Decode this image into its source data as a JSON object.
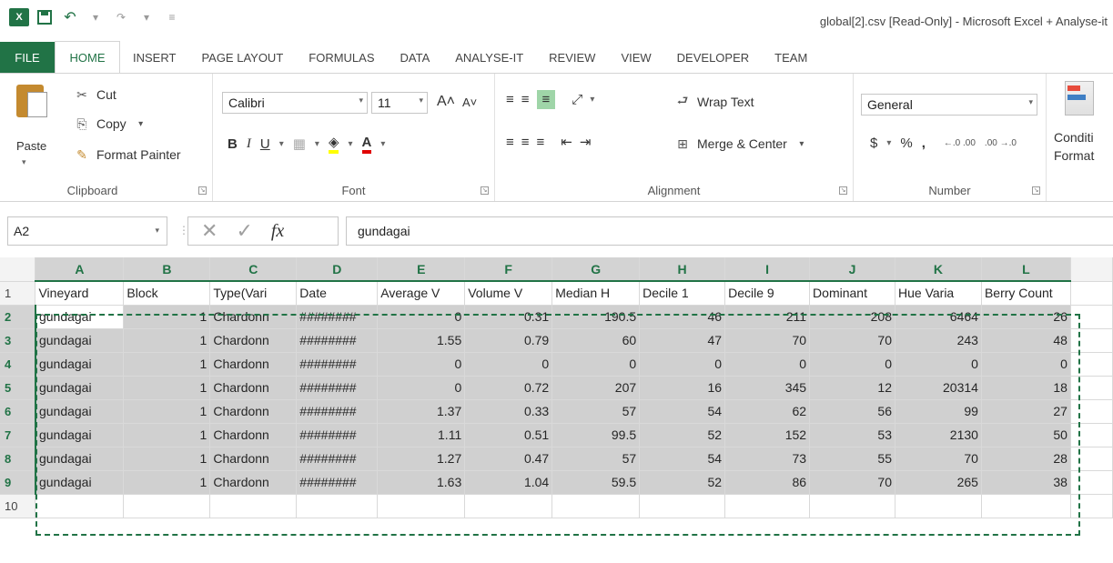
{
  "window": {
    "logo": "X",
    "title": "global[2].csv  [Read-Only] - Microsoft Excel + Analyse-it"
  },
  "tabs": [
    "FILE",
    "HOME",
    "INSERT",
    "PAGE LAYOUT",
    "FORMULAS",
    "DATA",
    "ANALYSE-IT",
    "REVIEW",
    "VIEW",
    "DEVELOPER",
    "TEAM"
  ],
  "ribbon": {
    "clipboard": {
      "paste": "Paste",
      "cut": "Cut",
      "copy": "Copy",
      "format_painter": "Format Painter",
      "label": "Clipboard"
    },
    "font": {
      "name": "Calibri",
      "size": "11",
      "label": "Font",
      "bold": "B",
      "italic": "I",
      "underline": "U"
    },
    "alignment": {
      "wrap_text": "Wrap Text",
      "merge_center": "Merge & Center",
      "label": "Alignment"
    },
    "number": {
      "format": "General",
      "currency": "$",
      "percent": "%",
      "comma": ",",
      "label": "Number",
      "inc_decimal": "←.0 .00",
      "dec_decimal": ".00 →.0"
    },
    "styles": {
      "conditional_formatting": "Conditi",
      "format": "Format"
    }
  },
  "formula_bar": {
    "name_box": "A2",
    "fx": "fx",
    "value": "gundagai"
  },
  "grid": {
    "columns": [
      "A",
      "B",
      "C",
      "D",
      "E",
      "F",
      "G",
      "H",
      "I",
      "J",
      "K",
      "L"
    ],
    "header_row": [
      "Vineyard",
      "Block",
      "Type(Vari",
      "Date",
      "Average V",
      "Volume V",
      "Median H",
      "Decile 1",
      "Decile 9",
      "Dominant",
      "Hue Varia",
      "Berry Count"
    ],
    "rows": [
      [
        "gundagai",
        "1",
        "Chardonn",
        "########",
        "0",
        "0.31",
        "190.5",
        "46",
        "211",
        "208",
        "6464",
        "26"
      ],
      [
        "gundagai",
        "1",
        "Chardonn",
        "########",
        "1.55",
        "0.79",
        "60",
        "47",
        "70",
        "70",
        "243",
        "48"
      ],
      [
        "gundagai",
        "1",
        "Chardonn",
        "########",
        "0",
        "0",
        "0",
        "0",
        "0",
        "0",
        "0",
        "0"
      ],
      [
        "gundagai",
        "1",
        "Chardonn",
        "########",
        "0",
        "0.72",
        "207",
        "16",
        "345",
        "12",
        "20314",
        "18"
      ],
      [
        "gundagai",
        "1",
        "Chardonn",
        "########",
        "1.37",
        "0.33",
        "57",
        "54",
        "62",
        "56",
        "99",
        "27"
      ],
      [
        "gundagai",
        "1",
        "Chardonn",
        "########",
        "1.11",
        "0.51",
        "99.5",
        "52",
        "152",
        "53",
        "2130",
        "50"
      ],
      [
        "gundagai",
        "1",
        "Chardonn",
        "########",
        "1.27",
        "0.47",
        "57",
        "54",
        "73",
        "55",
        "70",
        "28"
      ],
      [
        "gundagai",
        "1",
        "Chardonn",
        "########",
        "1.63",
        "1.04",
        "59.5",
        "52",
        "86",
        "70",
        "265",
        "38"
      ]
    ],
    "row_numbers": [
      "1",
      "2",
      "3",
      "4",
      "5",
      "6",
      "7",
      "8",
      "9",
      "10"
    ]
  },
  "colors": {
    "accent": "#217346",
    "selection": "#d0d0d0"
  }
}
